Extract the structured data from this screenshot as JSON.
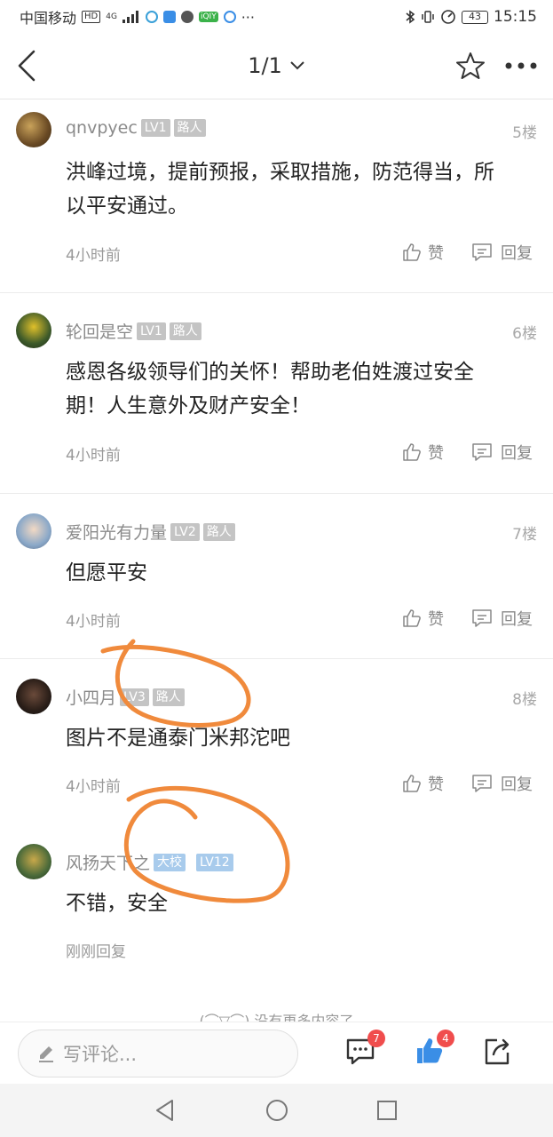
{
  "status_bar": {
    "carrier": "中国移动",
    "hd": "HD",
    "network": "4G",
    "battery": "43",
    "time": "15:15",
    "dots": "···",
    "app_badge": "iQIY"
  },
  "header": {
    "page_indicator": "1/1"
  },
  "comments": [
    {
      "username": "qnvpyec",
      "level": "LV1",
      "role": "路人",
      "floor": "5楼",
      "text": "洪峰过境，提前预报，采取措施，防范得当，所以平安通过。",
      "time": "4小时前",
      "like_label": "赞",
      "reply_label": "回复"
    },
    {
      "username": "轮回是空",
      "level": "LV1",
      "role": "路人",
      "floor": "6楼",
      "text": "感恩各级领导们的关怀！帮助老伯姓渡过安全期！人生意外及财产安全！",
      "time": "4小时前",
      "like_label": "赞",
      "reply_label": "回复"
    },
    {
      "username": "爱阳光有力量",
      "level": "LV2",
      "role": "路人",
      "floor": "7楼",
      "text": "但愿平安",
      "time": "4小时前",
      "like_label": "赞",
      "reply_label": "回复"
    },
    {
      "username": "小四月",
      "level": "LV3",
      "role": "路人",
      "floor": "8楼",
      "text": "图片不是通泰门米邦沱吧",
      "time": "4小时前",
      "like_label": "赞",
      "reply_label": "回复"
    }
  ],
  "reply": {
    "username": "风扬天下之",
    "title_badge": "大校",
    "level": "LV12",
    "text": "不错，安全",
    "time": "刚刚回复"
  },
  "no_more_text": "(⌒▽⌒) 没有更多内容了",
  "bottom_bar": {
    "input_placeholder": "写评论...",
    "comment_count": "7",
    "like_count": "4"
  },
  "colors": {
    "annotation": "#f08a3c",
    "badge_gray": "#c4c4c4",
    "badge_blue": "#a8cbec",
    "count_red": "#f04d4d",
    "like_blue": "#3a8ee6"
  }
}
